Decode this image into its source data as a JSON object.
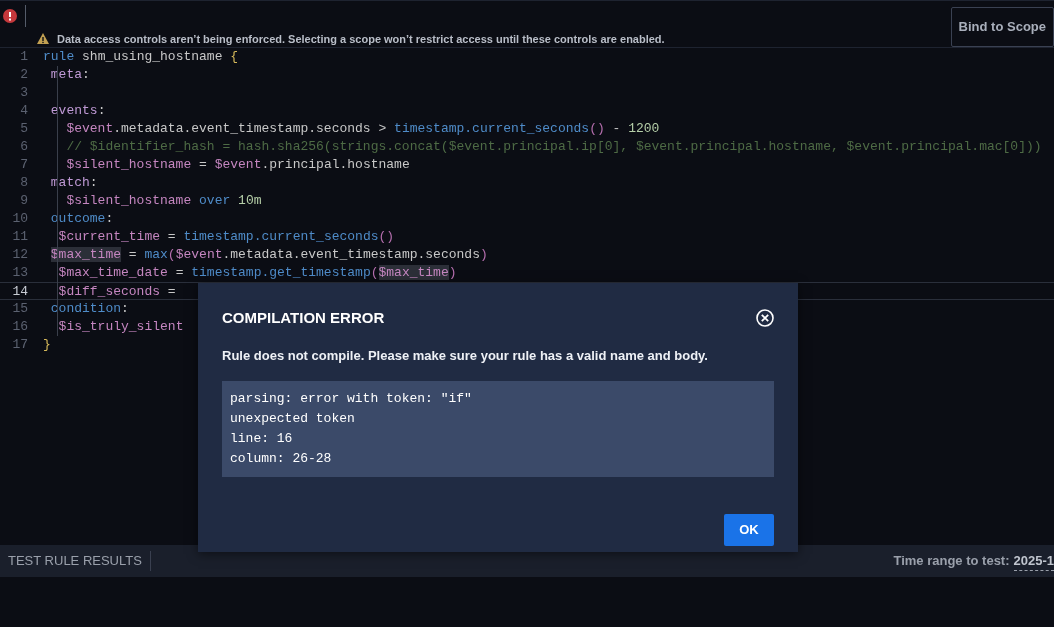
{
  "top_bar": {
    "warning": "Data access controls aren’t being enforced. Selecting a scope won’t restrict access until these controls are enabled.",
    "bind_button": "Bind to Scope"
  },
  "editor": {
    "lines": [
      {
        "number": "1",
        "current": false,
        "tokens": [
          {
            "kind": "keyword",
            "text": "rule"
          },
          {
            "kind": "plain",
            "text": " shm_using_hostname "
          },
          {
            "kind": "brace",
            "text": "{"
          }
        ]
      },
      {
        "number": "2",
        "current": false,
        "tokens": [
          {
            "kind": "section",
            "text": " meta"
          },
          {
            "kind": "plain",
            "text": ":"
          }
        ]
      },
      {
        "number": "3",
        "current": false
      },
      {
        "number": "4",
        "current": false,
        "tokens": [
          {
            "kind": "section",
            "text": " events"
          },
          {
            "kind": "plain",
            "text": ":"
          }
        ]
      },
      {
        "number": "5",
        "current": false,
        "tokens": [
          {
            "kind": "variable",
            "text": "   $event"
          },
          {
            "kind": "plain",
            "text": ".metadata.event_timestamp.seconds > "
          },
          {
            "kind": "function",
            "text": "timestamp.current_seconds"
          },
          {
            "kind": "paren",
            "text": "()"
          },
          {
            "kind": "plain",
            "text": " - "
          },
          {
            "kind": "number",
            "text": "1200"
          }
        ]
      },
      {
        "number": "6",
        "current": false,
        "tokens": [
          {
            "kind": "comment",
            "text": "   // $identifier_hash = hash.sha256(strings.concat($event.principal.ip[0], $event.principal.hostname, $event.principal.mac[0]))"
          }
        ]
      },
      {
        "number": "7",
        "current": false,
        "tokens": [
          {
            "kind": "variable",
            "text": "   $silent_hostname"
          },
          {
            "kind": "plain",
            "text": " = "
          },
          {
            "kind": "variable",
            "text": "$event"
          },
          {
            "kind": "plain",
            "text": ".principal.hostname"
          }
        ]
      },
      {
        "number": "8",
        "current": false,
        "tokens": [
          {
            "kind": "section",
            "text": " match"
          },
          {
            "kind": "plain",
            "text": ":"
          }
        ]
      },
      {
        "number": "9",
        "current": false,
        "tokens": [
          {
            "kind": "variable",
            "text": "   $silent_hostname"
          },
          {
            "kind": "keyword",
            "text": " over"
          },
          {
            "kind": "number",
            "text": " 10m"
          }
        ]
      },
      {
        "number": "10",
        "current": false,
        "tokens": [
          {
            "kind": "keyword",
            "text": " outcome"
          },
          {
            "kind": "plain",
            "text": ":"
          }
        ]
      },
      {
        "number": "11",
        "current": false,
        "tokens": [
          {
            "kind": "variable",
            "text": "  $current_time"
          },
          {
            "kind": "plain",
            "text": " = "
          },
          {
            "kind": "function",
            "text": "timestamp.current_seconds"
          },
          {
            "kind": "paren",
            "text": "()"
          }
        ]
      },
      {
        "number": "12",
        "current": false,
        "tokens": [
          {
            "kind": "variable",
            "text": " $max_time",
            "highlighted": true
          },
          {
            "kind": "plain",
            "text": " = "
          },
          {
            "kind": "function",
            "text": "max"
          },
          {
            "kind": "paren",
            "text": "("
          },
          {
            "kind": "variable",
            "text": "$event"
          },
          {
            "kind": "plain",
            "text": ".metadata.event_timestamp.seconds"
          },
          {
            "kind": "paren",
            "text": ")"
          }
        ]
      },
      {
        "number": "13",
        "current": false,
        "tokens": [
          {
            "kind": "variable",
            "text": "  $max_time_date"
          },
          {
            "kind": "plain",
            "text": " = "
          },
          {
            "kind": "function",
            "text": "timestamp.get_timestamp"
          },
          {
            "kind": "paren",
            "text": "("
          },
          {
            "kind": "variable",
            "text": "$max_time",
            "highlighted": true
          },
          {
            "kind": "paren",
            "text": ")"
          }
        ]
      },
      {
        "number": "14",
        "current": true,
        "tokens": [
          {
            "kind": "variable",
            "text": "  $diff_seconds"
          },
          {
            "kind": "plain",
            "text": " ="
          }
        ]
      },
      {
        "number": "15",
        "current": false,
        "tokens": [
          {
            "kind": "keyword",
            "text": " condition"
          },
          {
            "kind": "plain",
            "text": ":"
          }
        ]
      },
      {
        "number": "16",
        "current": false,
        "tokens": [
          {
            "kind": "variable",
            "text": "  $is_truly_silent"
          }
        ]
      },
      {
        "number": "17",
        "current": false,
        "tokens": [
          {
            "kind": "brace",
            "text": "}"
          }
        ]
      }
    ]
  },
  "modal": {
    "title": "COMPILATION ERROR",
    "message": "Rule does not compile. Please make sure your rule has a valid name and body.",
    "error_lines": [
      "parsing: error with token: \"if\"",
      "unexpected token",
      "line: 16",
      "column: 26-28"
    ],
    "ok_button": "OK"
  },
  "bottom_bar": {
    "title": "TEST RULE RESULTS",
    "time_range_label": "Time range to test:",
    "time_range_value": "2025-1"
  }
}
